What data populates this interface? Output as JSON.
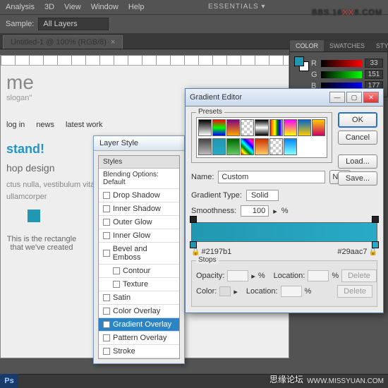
{
  "menu": {
    "items": [
      "Analysis",
      "3D",
      "View",
      "Window",
      "Help"
    ]
  },
  "toolbar": {
    "sample_label": "Sample:",
    "sample_value": "All Layers"
  },
  "workspace": "ESSENTIALS ▾",
  "watermark_top_a": "BBS.16",
  "watermark_top_xx": "XX",
  "watermark_top_b": "8.COM",
  "doc_tab": "Untitled-1 @ 100% (RGB/8)",
  "canvas": {
    "name_suffix": "me",
    "slogan": "slogan\"",
    "nav": [
      "log in",
      "news",
      "latest work"
    ],
    "headline": "stand!",
    "subhead": "hop design",
    "body": "ctus nulla, vestibulum vitae arcu. In a sem a nibh faucibus turpis ultricies ullamcorper",
    "callout": "This is the rectangle that we've created"
  },
  "color_panel": {
    "tabs": [
      "COLOR",
      "SWATCHES",
      "STYLES"
    ],
    "r": "33",
    "g": "151",
    "b": "177"
  },
  "layer_style": {
    "title": "Layer Style",
    "header": "Styles",
    "blend": "Blending Options: Default",
    "items": [
      "Drop Shadow",
      "Inner Shadow",
      "Outer Glow",
      "Inner Glow",
      "Bevel and Emboss",
      "Contour",
      "Texture",
      "Satin",
      "Color Overlay",
      "Gradient Overlay",
      "Pattern Overlay",
      "Stroke"
    ],
    "selected": "Gradient Overlay"
  },
  "gradient": {
    "title": "Gradient Editor",
    "presets_label": "Presets",
    "ok": "OK",
    "cancel": "Cancel",
    "load": "Load...",
    "save": "Save...",
    "new": "New",
    "name_label": "Name:",
    "name_value": "Custom",
    "type_label": "Gradient Type:",
    "type_value": "Solid",
    "smooth_label": "Smoothness:",
    "smooth_value": "100",
    "smooth_unit": "%",
    "hex_left": "#2197b1",
    "hex_right": "#29aac7",
    "stops_label": "Stops",
    "opacity_label": "Opacity:",
    "location_label": "Location:",
    "pct": "%",
    "color_label": "Color:",
    "delete": "Delete"
  },
  "watermark_bot": "思缘论坛",
  "watermark_bot2": "WWW.MISSYUAN.COM",
  "ps": "Ps"
}
